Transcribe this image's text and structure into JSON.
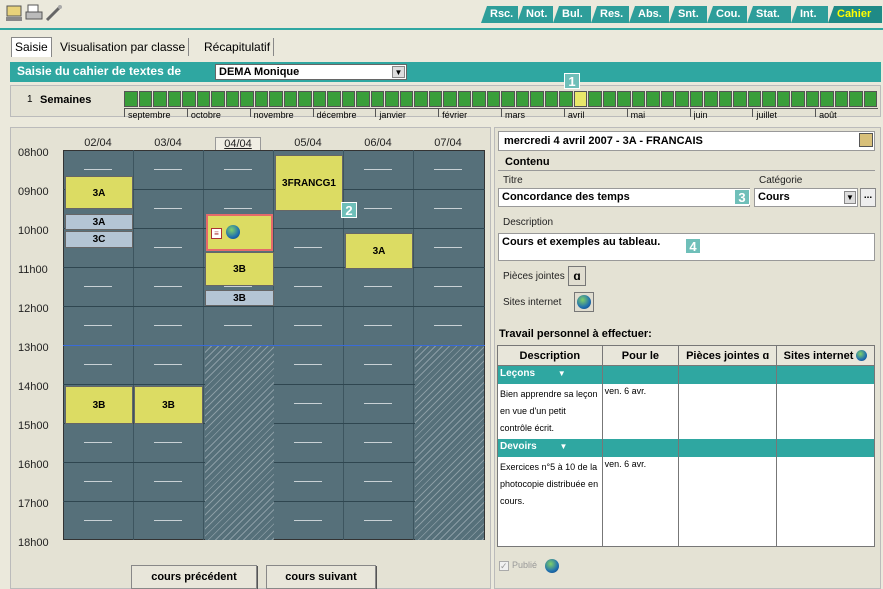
{
  "toolbar_icons": [
    "computer-icon",
    "print-icon",
    "tools-icon"
  ],
  "main_tabs": [
    "Rsc.",
    "Not.",
    "Bul.",
    "Res.",
    "Abs.",
    "Snt.",
    "Cou.",
    "Stat.",
    "Int.",
    "Cahier"
  ],
  "sub_tabs": [
    "Saisie",
    "Visualisation par classe",
    "Récapitulatif"
  ],
  "header": {
    "label": "Saisie du cahier de textes de",
    "teacher": "DEMA Monique"
  },
  "weeks": {
    "number": "1",
    "label": "Semaines",
    "months": [
      "septembre",
      "octobre",
      "novembre",
      "décembre",
      "janvier",
      "février",
      "mars",
      "avril",
      "mai",
      "juin",
      "juillet",
      "août"
    ]
  },
  "badges": [
    "1",
    "2",
    "3",
    "4"
  ],
  "schedule": {
    "days": [
      "02/04",
      "03/04",
      "04/04",
      "05/04",
      "06/04",
      "07/04"
    ],
    "hours": [
      "08h00",
      "09h00",
      "10h00",
      "11h00",
      "12h00",
      "13h00",
      "14h00",
      "15h00",
      "16h00",
      "17h00",
      "18h00"
    ],
    "events": {
      "e1": "3A",
      "e2": "3A",
      "e3": "3C",
      "e4": "3FRANCG1",
      "e5": "3A",
      "e6": "3B",
      "e7": "3B",
      "e8": "3B",
      "e9": "3B"
    },
    "prev_button": "cours précédent",
    "next_button": "cours suivant"
  },
  "detail": {
    "date_title": "mercredi 4 avril 2007 - 3A - FRANCAIS",
    "contenu": "Contenu",
    "titre_label": "Titre",
    "titre_value": "Concordance des temps",
    "categorie_label": "Catégorie",
    "categorie_value": "Cours",
    "more_button": "...",
    "description_label": "Description",
    "description_value": "Cours et exemples au tableau.",
    "pieces_label": "Pièces jointes",
    "sites_label": "Sites internet"
  },
  "travail": {
    "title": "Travail personnel à effectuer:",
    "columns": [
      "Description",
      "Pour le",
      "Pièces jointes",
      "Sites internet"
    ],
    "sections": [
      {
        "name": "Leçons",
        "rows": [
          {
            "description": "Bien apprendre sa leçon en vue d'un petit contrôle écrit.",
            "pour_le": "ven. 6 avr."
          }
        ]
      },
      {
        "name": "Devoirs",
        "rows": [
          {
            "description": "Exercices n°5 à 10 de la photocopie distribuée en cours.",
            "pour_le": "ven. 6 avr."
          }
        ]
      }
    ]
  },
  "publie_label": "Publié",
  "colors": {
    "teal": "#2fa7a1",
    "event_yellow": "#dcdc63",
    "event_blue": "#b4c5d4",
    "grid": "#56707a"
  }
}
